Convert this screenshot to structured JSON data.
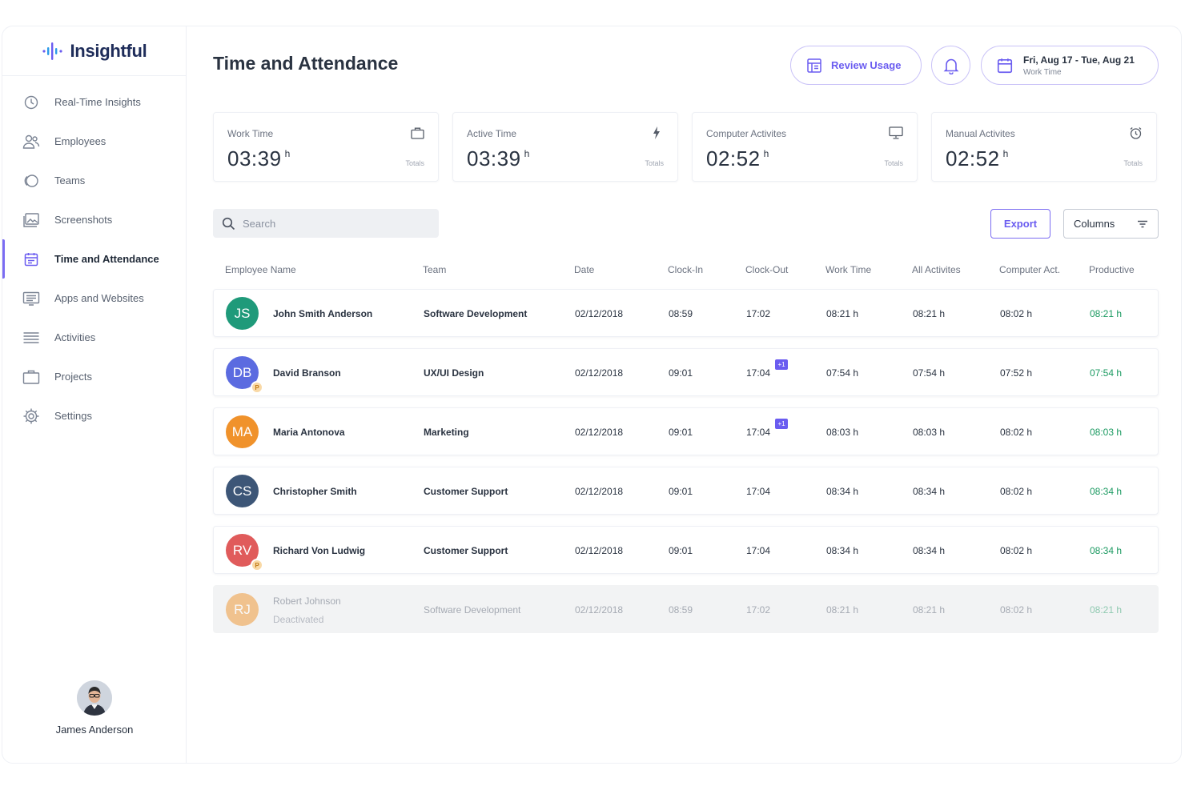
{
  "app": {
    "logo_text": "Insightful",
    "page_title": "Time and Attendance"
  },
  "sidebar": {
    "items": [
      {
        "label": "Real-Time Insights",
        "icon": "clock-icon",
        "active": false
      },
      {
        "label": "Employees",
        "icon": "users-icon",
        "active": false
      },
      {
        "label": "Teams",
        "icon": "teams-icon",
        "active": false
      },
      {
        "label": "Screenshots",
        "icon": "screenshots-icon",
        "active": false
      },
      {
        "label": "Time and Attendance",
        "icon": "calendar-icon",
        "active": true
      },
      {
        "label": "Apps and Websites",
        "icon": "apps-icon",
        "active": false
      },
      {
        "label": "Activities",
        "icon": "list-icon",
        "active": false
      },
      {
        "label": "Projects",
        "icon": "briefcase-icon",
        "active": false
      },
      {
        "label": "Settings",
        "icon": "gear-icon",
        "active": false
      }
    ],
    "user_name": "James Anderson"
  },
  "header": {
    "review_usage_label": "Review Usage",
    "date_range": "Fri, Aug 17 - Tue, Aug 21",
    "date_sub": "Work Time"
  },
  "stats": [
    {
      "label": "Work Time",
      "value": "03:39",
      "unit": "h",
      "foot": "Totals",
      "icon": "briefcase-icon"
    },
    {
      "label": "Active Time",
      "value": "03:39",
      "unit": "h",
      "foot": "Totals",
      "icon": "lightning-icon"
    },
    {
      "label": "Computer Activites",
      "value": "02:52",
      "unit": "h",
      "foot": "Totals",
      "icon": "monitor-icon"
    },
    {
      "label": "Manual Activites",
      "value": "02:52",
      "unit": "h",
      "foot": "Totals",
      "icon": "alarm-icon"
    }
  ],
  "toolbar": {
    "search_placeholder": "Search",
    "export_label": "Export",
    "columns_label": "Columns"
  },
  "table": {
    "headers": [
      "Employee Name",
      "Team",
      "Date",
      "Clock-In",
      "Clock-Out",
      "Work Time",
      "All Activites",
      "Computer Act.",
      "Productive"
    ],
    "rows": [
      {
        "initials": "JS",
        "color": "#1f9a7a",
        "name": "John Smith Anderson",
        "badge": "",
        "sub": "",
        "team": "Software Development",
        "date": "02/12/2018",
        "clock_in": "08:59",
        "clock_out": "17:02",
        "plus": "",
        "work": "08:21 h",
        "all": "08:21 h",
        "computer": "08:02 h",
        "productive": "08:21 h",
        "deactivated": false
      },
      {
        "initials": "DB",
        "color": "#5b6be0",
        "name": "David Branson",
        "badge": "P",
        "sub": "",
        "team": "UX/UI Design",
        "date": "02/12/2018",
        "clock_in": "09:01",
        "clock_out": "17:04",
        "plus": "+1",
        "work": "07:54 h",
        "all": "07:54 h",
        "computer": "07:52 h",
        "productive": "07:54 h",
        "deactivated": false
      },
      {
        "initials": "MA",
        "color": "#f0922b",
        "name": "Maria Antonova",
        "badge": "",
        "sub": "",
        "team": "Marketing",
        "date": "02/12/2018",
        "clock_in": "09:01",
        "clock_out": "17:04",
        "plus": "+1",
        "work": "08:03 h",
        "all": "08:03 h",
        "computer": "08:02 h",
        "productive": "08:03 h",
        "deactivated": false
      },
      {
        "initials": "CS",
        "color": "#3d5677",
        "name": "Christopher Smith",
        "badge": "",
        "sub": "",
        "team": "Customer Support",
        "date": "02/12/2018",
        "clock_in": "09:01",
        "clock_out": "17:04",
        "plus": "",
        "work": "08:34 h",
        "all": "08:34 h",
        "computer": "08:02 h",
        "productive": "08:34 h",
        "deactivated": false
      },
      {
        "initials": "RV",
        "color": "#e05b5b",
        "name": "Richard Von Ludwig",
        "badge": "P",
        "sub": "",
        "team": "Customer Support",
        "date": "02/12/2018",
        "clock_in": "09:01",
        "clock_out": "17:04",
        "plus": "",
        "work": "08:34 h",
        "all": "08:34 h",
        "computer": "08:02 h",
        "productive": "08:34 h",
        "deactivated": false
      },
      {
        "initials": "RJ",
        "color": "#f0922b",
        "name": "Robert Johnson",
        "badge": "",
        "sub": "Deactivated",
        "team": "Software Development",
        "date": "02/12/2018",
        "clock_in": "08:59",
        "clock_out": "17:02",
        "plus": "",
        "work": "08:21 h",
        "all": "08:21 h",
        "computer": "08:02 h",
        "productive": "08:21 h",
        "deactivated": true
      }
    ]
  },
  "colors": {
    "accent": "#6a5cf0",
    "productive": "#1b9a61"
  }
}
